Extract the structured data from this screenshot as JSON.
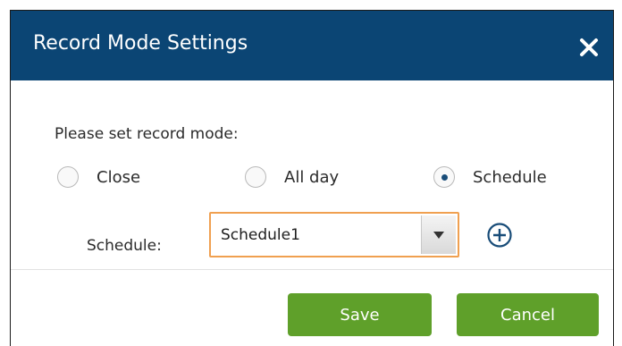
{
  "dialog": {
    "title": "Record Mode Settings",
    "close_icon": "close-icon"
  },
  "prompt": "Please set record mode:",
  "mode_options": [
    {
      "label": "Close",
      "checked": false
    },
    {
      "label": "All day",
      "checked": false
    },
    {
      "label": "Schedule",
      "checked": true
    }
  ],
  "schedule": {
    "label": "Schedule:",
    "selected": "Schedule1",
    "arrow_icon": "caret-down-icon",
    "add_icon": "plus-circle-icon"
  },
  "buttons": {
    "save_label": "Save",
    "cancel_label": "Cancel"
  },
  "colors": {
    "titlebar": "#0b4574",
    "button": "#5fa02a",
    "select_focus": "#f0a050"
  }
}
